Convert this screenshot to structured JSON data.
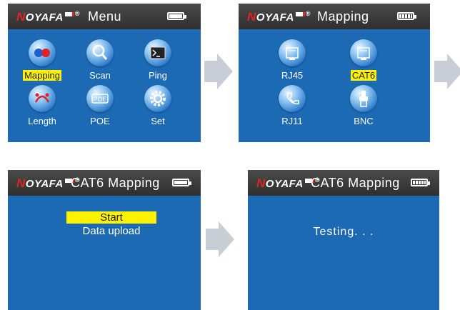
{
  "logo": {
    "text": "OYAFA",
    "first_letter": "N",
    "registered": "®"
  },
  "screen_menu": {
    "title": "Menu",
    "items": [
      {
        "label": "Mapping",
        "icon": "mapping-icon",
        "selected": true
      },
      {
        "label": "Scan",
        "icon": "magnifier-icon",
        "selected": false
      },
      {
        "label": "Ping",
        "icon": "terminal-icon",
        "selected": false
      },
      {
        "label": "Length",
        "icon": "length-icon",
        "selected": false
      },
      {
        "label": "POE",
        "icon": "poe-icon",
        "selected": false
      },
      {
        "label": "Set",
        "icon": "gear-icon",
        "selected": false
      }
    ]
  },
  "screen_mapping": {
    "title": "Mapping",
    "items": [
      {
        "label": "RJ45",
        "icon": "rj45-port-icon",
        "selected": false
      },
      {
        "label": "CAT6",
        "icon": "cat6-port-icon",
        "selected": true
      },
      {
        "label": "RJ11",
        "icon": "phone-icon",
        "selected": false
      },
      {
        "label": "BNC",
        "icon": "bnc-connector-icon",
        "selected": false
      }
    ]
  },
  "screen_cat6": {
    "title": "CAT6  Mapping",
    "items": [
      {
        "label": "Start",
        "selected": true
      },
      {
        "label": "Data upload",
        "selected": false
      }
    ]
  },
  "screen_testing": {
    "title": "CAT6  Mapping",
    "status": "Testing. . ."
  },
  "colors": {
    "screen_bg": "#1c69b4",
    "titlebar_bg": "#3a3a3a",
    "highlight": "#fff200",
    "arrow": "#c9ced6",
    "logo_red": "#e02424"
  }
}
